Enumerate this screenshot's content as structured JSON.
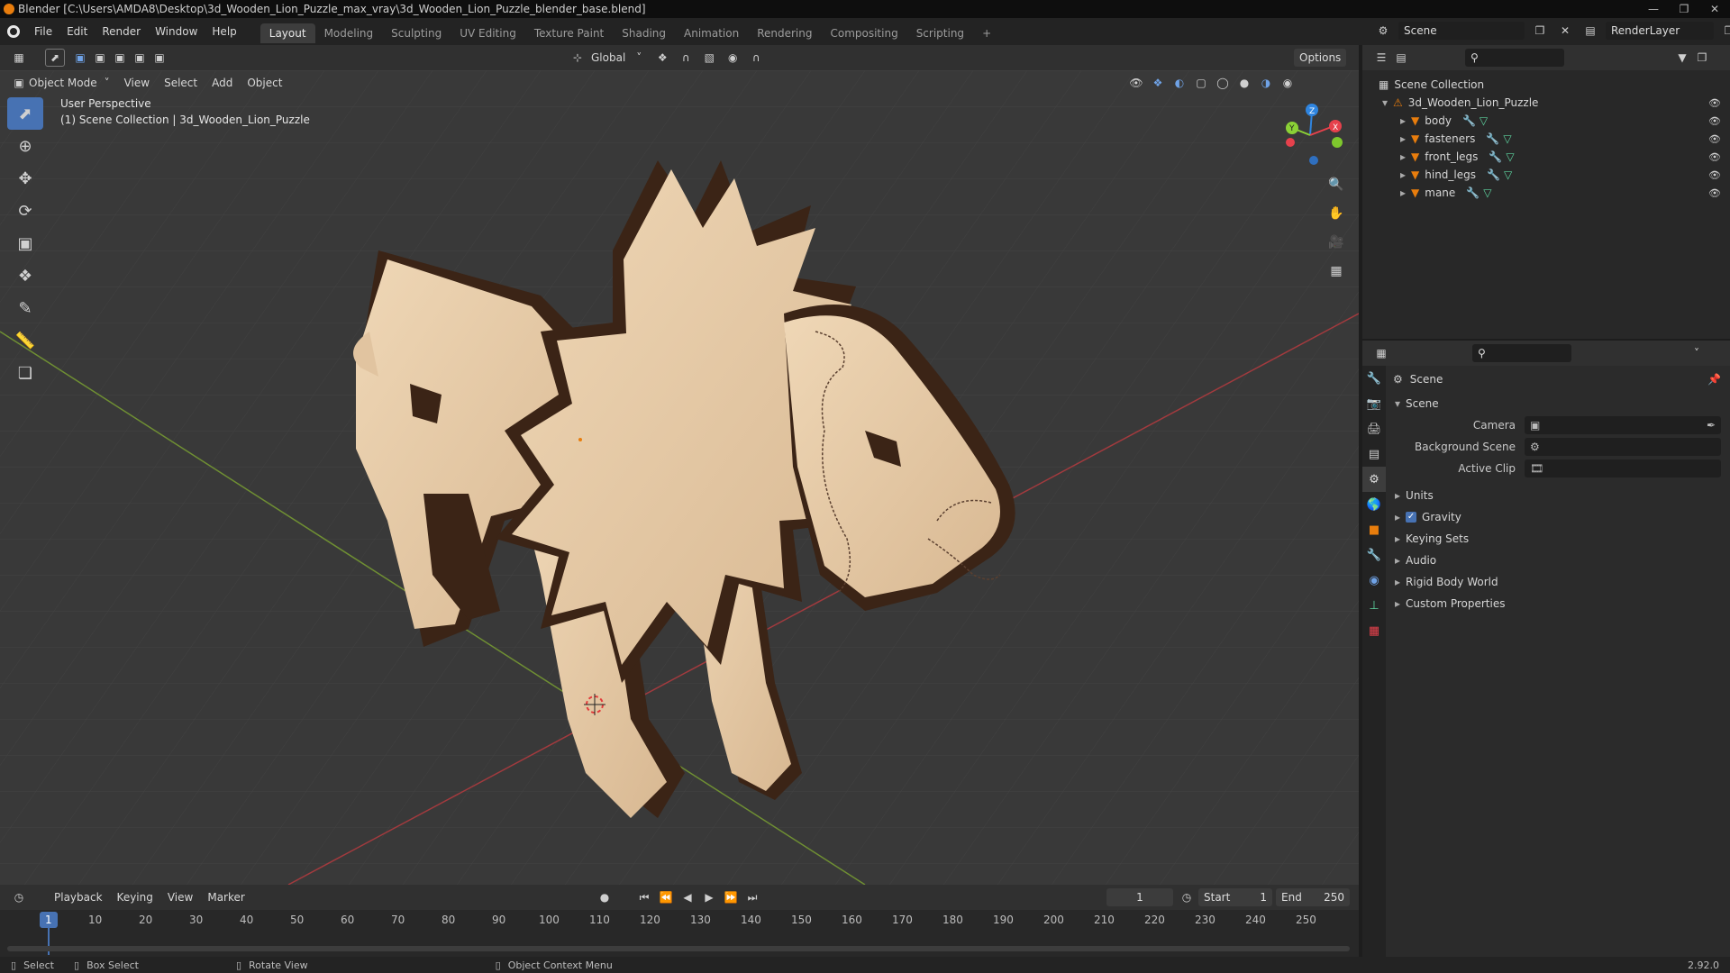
{
  "window": {
    "title": "Blender [C:\\Users\\AMDA8\\Desktop\\3d_Wooden_Lion_Puzzle_max_vray\\3d_Wooden_Lion_Puzzle_blender_base.blend]"
  },
  "menubar": {
    "items": [
      "File",
      "Edit",
      "Render",
      "Window",
      "Help"
    ],
    "workspaces": [
      "Layout",
      "Modeling",
      "Sculpting",
      "UV Editing",
      "Texture Paint",
      "Shading",
      "Animation",
      "Rendering",
      "Compositing",
      "Scripting"
    ],
    "add_tab": "+",
    "scene_name": "Scene",
    "view_layer": "RenderLayer"
  },
  "viewport_header": {
    "orientation": "Global",
    "options": "Options",
    "mode": "Object Mode",
    "menu": [
      "View",
      "Select",
      "Add",
      "Object"
    ]
  },
  "viewport": {
    "perspective": "User Perspective",
    "collection_info": "(1) Scene Collection | 3d_Wooden_Lion_Puzzle",
    "axes": {
      "x": "X",
      "y": "Y",
      "z": "Z"
    }
  },
  "outliner": {
    "root": "Scene Collection",
    "collection": "3d_Wooden_Lion_Puzzle",
    "objects": [
      "body",
      "fasteners",
      "front_legs",
      "hind_legs",
      "mane"
    ]
  },
  "properties": {
    "context": "Scene",
    "section": "Scene",
    "fields": [
      {
        "label": "Camera",
        "value": ""
      },
      {
        "label": "Background Scene",
        "value": ""
      },
      {
        "label": "Active Clip",
        "value": ""
      }
    ],
    "panels": [
      "Units",
      "Gravity",
      "Keying Sets",
      "Audio",
      "Rigid Body World",
      "Custom Properties"
    ],
    "gravity_enabled": true
  },
  "timeline": {
    "menu": [
      "Playback",
      "Keying",
      "View",
      "Marker"
    ],
    "current_frame": "1",
    "start_label": "Start",
    "start": "1",
    "end_label": "End",
    "end": "250",
    "ticks": [
      "1",
      "10",
      "20",
      "30",
      "40",
      "50",
      "60",
      "70",
      "80",
      "90",
      "100",
      "110",
      "120",
      "130",
      "140",
      "150",
      "160",
      "170",
      "180",
      "190",
      "200",
      "210",
      "220",
      "230",
      "240",
      "250"
    ]
  },
  "statusbar": {
    "select": "Select",
    "box_select": "Box Select",
    "rotate_view": "Rotate View",
    "context_menu": "Object Context Menu",
    "version": "2.92.0"
  },
  "colors": {
    "accent": "#4772b3",
    "x_axis": "#e6414c",
    "y_axis": "#8bd136",
    "z_axis": "#2f85e0",
    "wood_light": "#e8cda9",
    "wood_dark": "#3b2416",
    "orange": "#e87d0d"
  }
}
